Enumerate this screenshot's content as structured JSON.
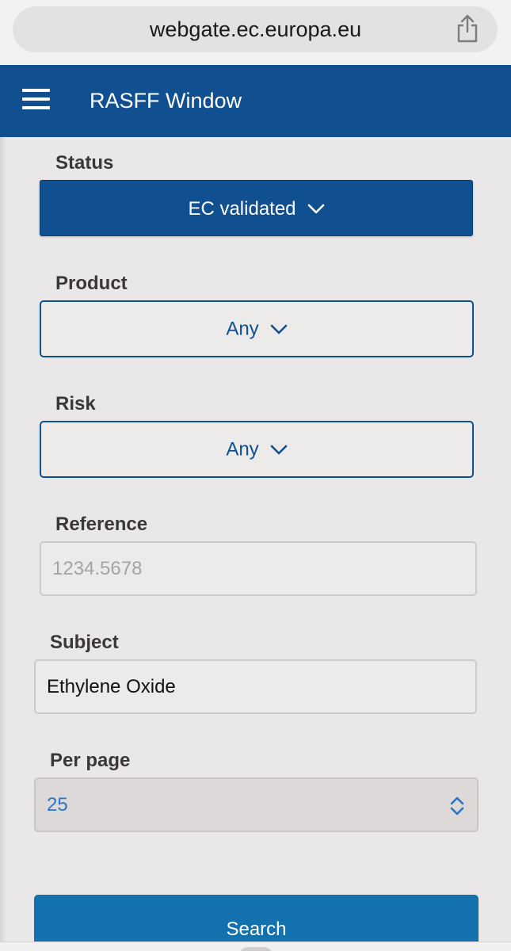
{
  "browser": {
    "url": "webgate.ec.europa.eu",
    "share_icon": "share-icon"
  },
  "header": {
    "menu_icon": "hamburger-menu-icon",
    "title": "RASFF Window",
    "background": "#104f90"
  },
  "form": {
    "status": {
      "label": "Status",
      "value": "EC validated"
    },
    "product": {
      "label": "Product",
      "value": "Any"
    },
    "risk": {
      "label": "Risk",
      "value": "Any"
    },
    "reference": {
      "label": "Reference",
      "placeholder": "1234.5678"
    },
    "subject": {
      "label": "Subject",
      "value": "Ethylene Oxide"
    },
    "per_page": {
      "label": "Per page",
      "value": "25"
    },
    "search_label": "Search"
  },
  "colors": {
    "primary": "#104f90",
    "search_button": "#1372ad",
    "select_value_text": "#2a74c7"
  }
}
